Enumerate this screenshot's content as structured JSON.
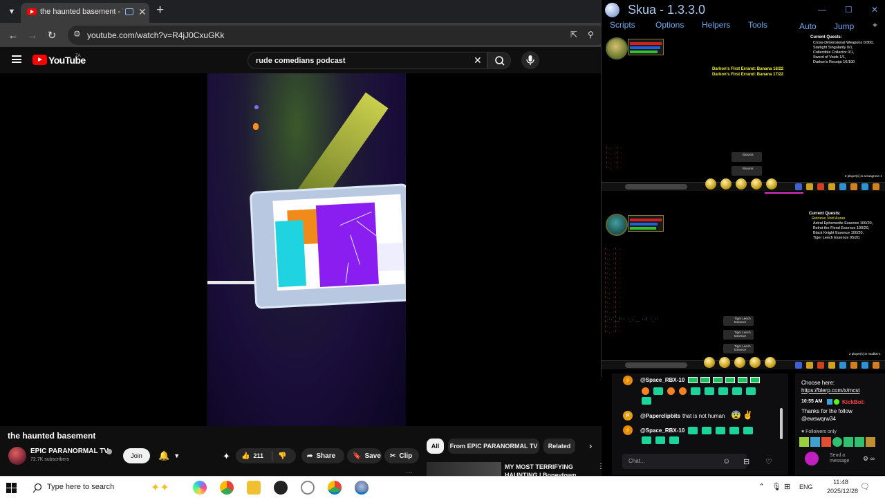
{
  "browser": {
    "tab_title": "the haunted basement - YouTube",
    "new_tab_symbol": "+",
    "url": "youtube.com/watch?v=R4jJ0CxuGKk"
  },
  "youtube": {
    "logo_text": "YouTube",
    "country_code": "ZA",
    "search_query": "rude comedians podcast",
    "video_title": "the haunted basement",
    "channel_name": "EPIC PARANORMAL TV",
    "subscribers": "72.7K subscribers",
    "join_label": "Join",
    "like_count": "211",
    "share_label": "Share",
    "save_label": "Save",
    "clip_label": "Clip",
    "chips": [
      "All",
      "From EPIC PARANORMAL TV",
      "Related"
    ],
    "rec_title": "MY MOST TERRIFYING HAUNTING | Boneytown School"
  },
  "skua": {
    "title": "Skua - 1.3.3.0",
    "menus": [
      "Scripts",
      "Options",
      "Helpers",
      "Tools"
    ],
    "right_menus": [
      "Auto",
      "Jump"
    ],
    "pane1": {
      "quest_header": "Current Quests:",
      "quests": [
        "Cross-Dimensional Weapons 0/300,",
        "Starlight Singularity 0/1,",
        "Collectible Collector 0/1,",
        "Sword of Voids 1/1,",
        "Darkon's Receipt 16/100"
      ],
      "banana_lines": [
        "Darkon's First Errand: Banana 16/22",
        "Darkon's First Errand: Banana 17/22"
      ],
      "item_tags": [
        "Banana",
        "Banana"
      ],
      "players_note": "2 player(s) in arcangrove-1"
    },
    "pane2": {
      "quest_header": "Current Quests:",
      "quests": [
        "Retrieve Void Auras",
        "Astral Ephemerite Essence 100/20,",
        "Belrot the Fiend Essence 100/20,",
        "Black Knight Essence 100/20,",
        "Tiger Leech Essence 95/20,"
      ],
      "item_tags": [
        "Tiger Leech Essence",
        "Tiger Leech Essence",
        "Tiger Leech Essence"
      ],
      "players_note": "2 player(s) in mudluk-1"
    }
  },
  "chat_left": {
    "messages": [
      {
        "avatar": "⚡",
        "user": "@Space_RBX-10",
        "text": ""
      },
      {
        "avatar": "P",
        "user": "@Paperclipbits",
        "text": "that is not human"
      },
      {
        "avatar": "⚡",
        "user": "@Space_RBX-10",
        "text": ""
      }
    ],
    "input_placeholder": "Chat..."
  },
  "chat_right": {
    "choose_here": "Choose here:",
    "link": "https://blerp.com/x/mcst",
    "time": "10:55 AM",
    "bot_name": "KickBot:",
    "message": "Thanks for the follow @ewswqrw34",
    "followers_only": "Followers only",
    "send_placeholder": "Send a message"
  },
  "taskbar": {
    "search_placeholder": "Type here to search",
    "lang": "ENG",
    "time": "11:48",
    "date": "2025/12/28"
  }
}
